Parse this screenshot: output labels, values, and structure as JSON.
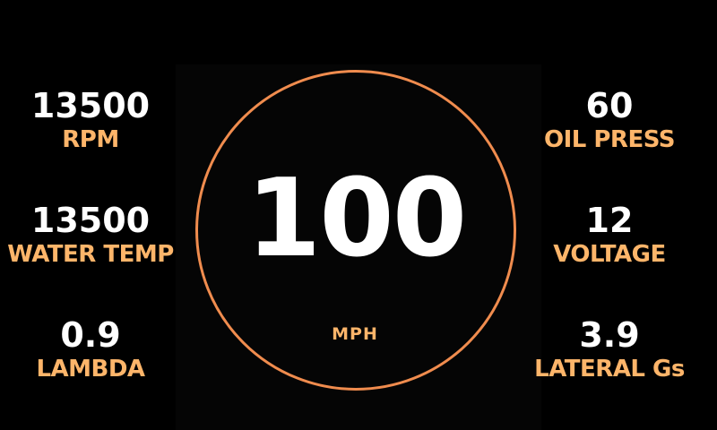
{
  "speedometer": {
    "value": "100",
    "unit": "MPH"
  },
  "left_gauges": [
    {
      "value": "13500",
      "label": "RPM"
    },
    {
      "value": "13500",
      "label": "WATER TEMP"
    },
    {
      "value": "0.9",
      "label": "LAMBDA"
    }
  ],
  "right_gauges": [
    {
      "value": "60",
      "label": "OIL PRESS"
    },
    {
      "value": "12",
      "label": "VOLTAGE"
    },
    {
      "value": "3.9",
      "label": "LATERAL Gs"
    }
  ],
  "colors": {
    "background": "#000000",
    "value_text": "#ffffff",
    "label_text": "#fdb56a",
    "ring": "#f08c4e"
  }
}
